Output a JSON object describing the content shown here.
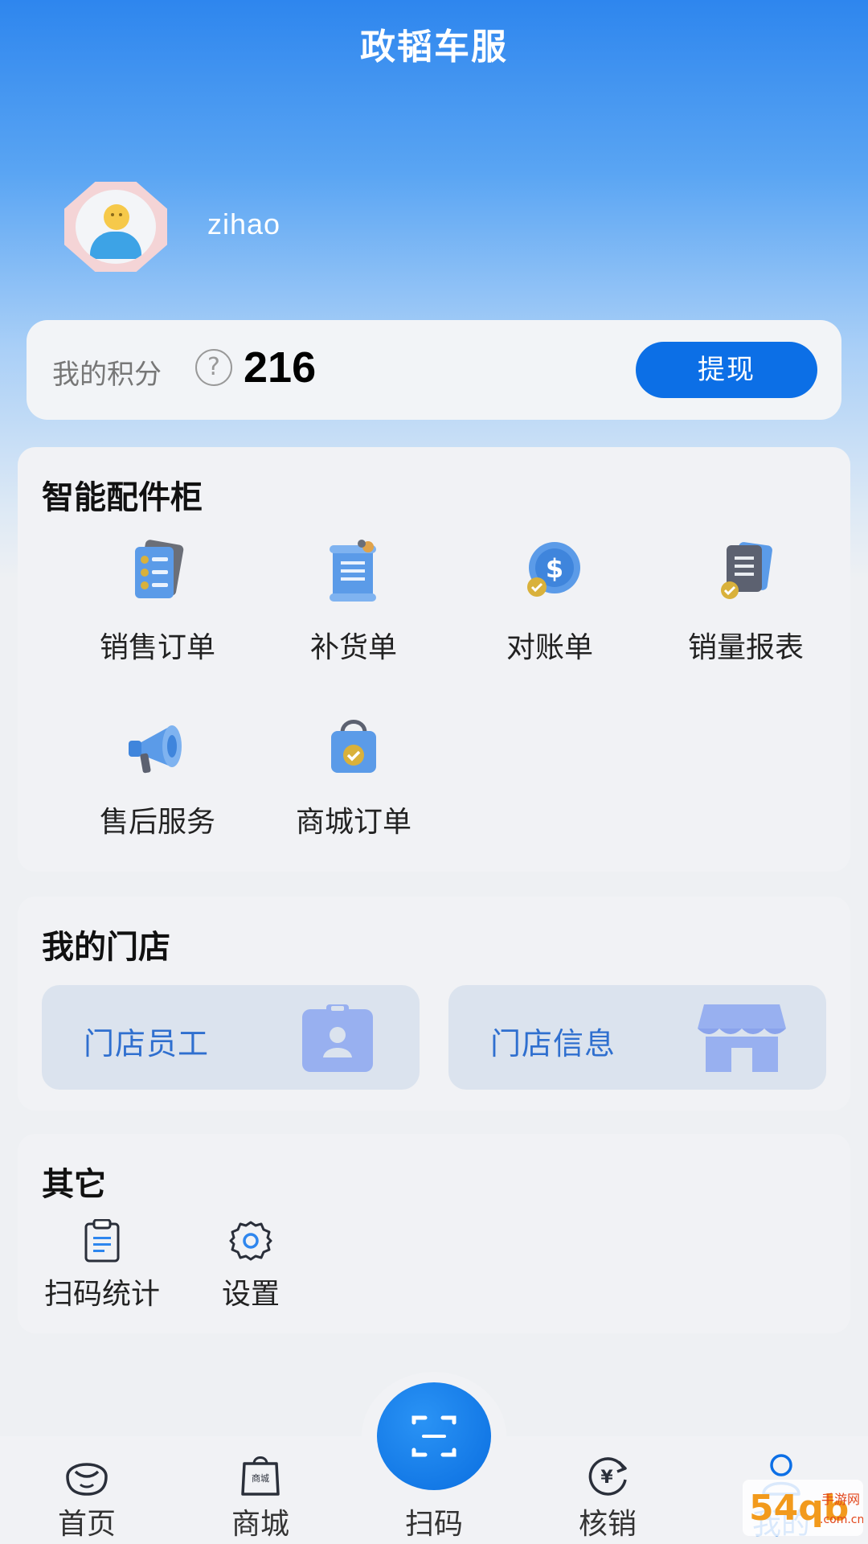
{
  "header": {
    "title": "政韬车服"
  },
  "user": {
    "name": "zihao"
  },
  "points": {
    "label": "我的积分",
    "help": "?",
    "value": "216",
    "withdraw_label": "提现"
  },
  "cabinet": {
    "title": "智能配件柜",
    "items": [
      {
        "label": "销售订单",
        "icon": "sales-order-icon"
      },
      {
        "label": "补货单",
        "icon": "restock-icon"
      },
      {
        "label": "对账单",
        "icon": "statement-icon"
      },
      {
        "label": "销量报表",
        "icon": "sales-report-icon"
      },
      {
        "label": "售后服务",
        "icon": "megaphone-icon"
      },
      {
        "label": "商城订单",
        "icon": "shopping-bag-icon"
      }
    ]
  },
  "store": {
    "title": "我的门店",
    "tiles": [
      {
        "label": "门店员工",
        "icon": "staff-badge-icon"
      },
      {
        "label": "门店信息",
        "icon": "storefront-icon"
      }
    ]
  },
  "other": {
    "title": "其它",
    "items": [
      {
        "label": "扫码统计",
        "icon": "clipboard-icon"
      },
      {
        "label": "设置",
        "icon": "gear-icon"
      }
    ]
  },
  "tabbar": {
    "tabs": [
      {
        "label": "首页",
        "icon": "home-face-icon"
      },
      {
        "label": "商城",
        "icon": "mall-bag-icon",
        "icon_text": "商城"
      },
      {
        "label": "扫码",
        "icon": "scan-icon"
      },
      {
        "label": "核销",
        "icon": "yen-cycle-icon",
        "icon_text": "¥"
      },
      {
        "label": "我的",
        "icon": "person-icon"
      }
    ]
  },
  "watermark": {
    "text": "54qb",
    "sub": "手游网",
    "domain": ".com.cn"
  },
  "colors": {
    "primary": "#0c6fe6",
    "tile_bg": "#dbe3ee",
    "tile_text": "#2f6fcf",
    "icon_blue": "#4a90e2"
  }
}
